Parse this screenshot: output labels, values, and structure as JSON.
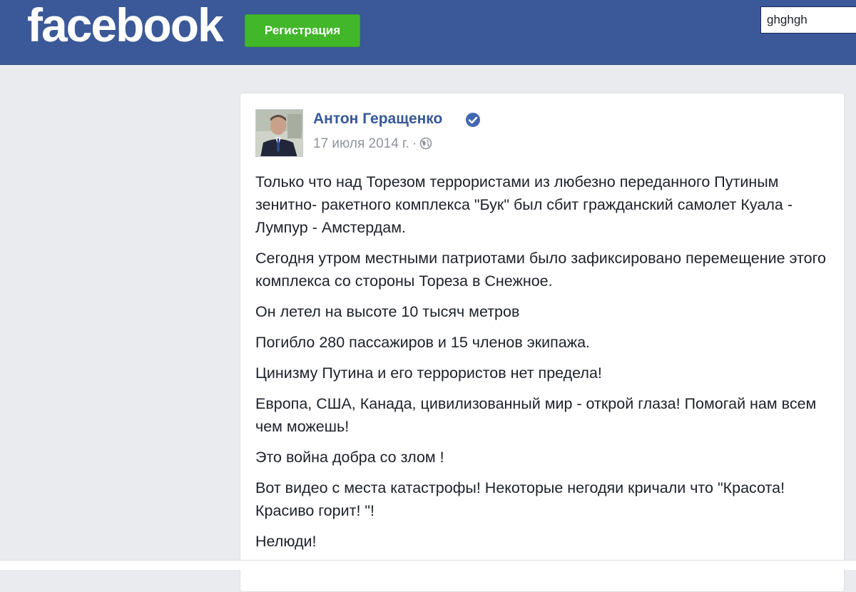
{
  "header": {
    "logo_text": "facebook",
    "register_label": "Регистрация",
    "search_value": "ghghgh"
  },
  "post": {
    "author": "Антон Геращенко",
    "date": "17 июля 2014 г.",
    "separator": "·",
    "privacy_icon": "globe-icon",
    "verified_icon": "verified-badge-icon",
    "paragraphs": [
      "Только что над Торезом террористами из любезно переданного Путиным зенитно- ракетного комплекса \"Бук\" был сбит гражданский самолет Куала - Лумпур - Амстердам.",
      "Сегодня утром местными патриотами было зафиксировано перемещение этого комплекса со стороны Тореза в Снежное.",
      "Он летел на высоте 10 тысяч метров",
      "Погибло 280 пассажиров и 15 членов экипажа.",
      "Цинизму Путина и его террористов нет предела!",
      "Европа, США, Канада, цивилизованный мир - открой глаза! Помогай нам всем чем можешь!",
      "Это война добра со злом !",
      "Вот видео с места катастрофы! Некоторые негодяи кричали что \"Красота! Красиво горит! \"!",
      "Нелюди!"
    ]
  },
  "colors": {
    "brand_blue": "#3b5998",
    "register_green": "#42b72a",
    "link_blue": "#365899",
    "page_background": "#e9ebee",
    "meta_gray": "#90949c",
    "verified_blue": "#4267b2"
  }
}
